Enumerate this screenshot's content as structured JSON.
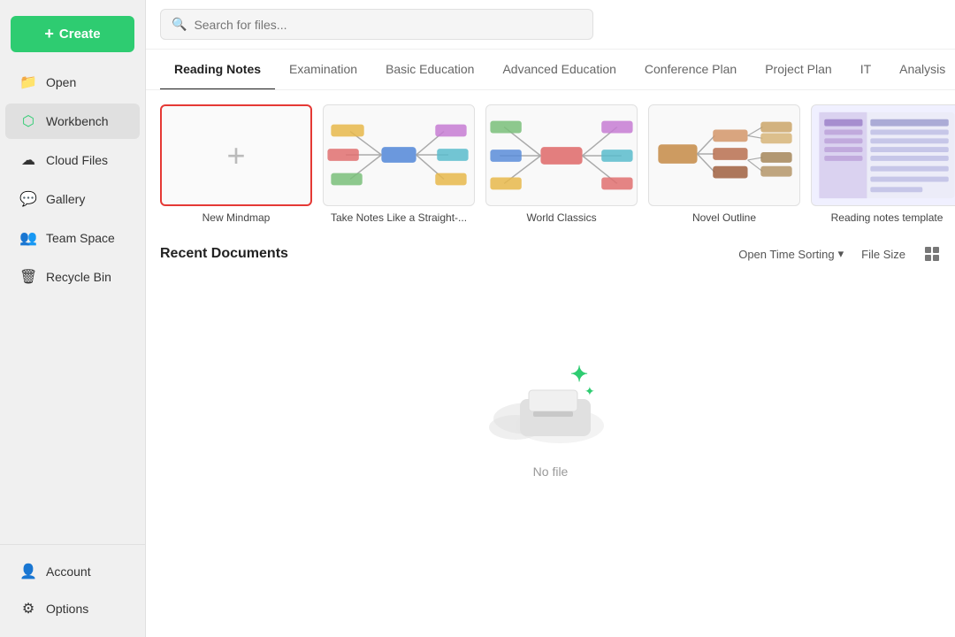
{
  "sidebar": {
    "create_label": "Create",
    "items": [
      {
        "id": "open",
        "label": "Open",
        "icon": "📁"
      },
      {
        "id": "workbench",
        "label": "Workbench",
        "icon": "🟢",
        "active": true
      },
      {
        "id": "cloud-files",
        "label": "Cloud Files",
        "icon": "☁️"
      },
      {
        "id": "gallery",
        "label": "Gallery",
        "icon": "💬"
      },
      {
        "id": "team-space",
        "label": "Team Space",
        "icon": "👥"
      },
      {
        "id": "recycle-bin",
        "label": "Recycle Bin",
        "icon": "🗑️"
      }
    ],
    "bottom_items": [
      {
        "id": "account",
        "label": "Account",
        "icon": "👤"
      },
      {
        "id": "options",
        "label": "Options",
        "icon": "⚙️"
      }
    ]
  },
  "topbar": {
    "search_placeholder": "Search for files..."
  },
  "tabs": [
    {
      "id": "reading-notes",
      "label": "Reading Notes",
      "active": true
    },
    {
      "id": "examination",
      "label": "Examination",
      "active": false
    },
    {
      "id": "basic-education",
      "label": "Basic Education",
      "active": false
    },
    {
      "id": "advanced-education",
      "label": "Advanced Education",
      "active": false
    },
    {
      "id": "conference-plan",
      "label": "Conference Plan",
      "active": false
    },
    {
      "id": "project-plan",
      "label": "Project Plan",
      "active": false
    },
    {
      "id": "it",
      "label": "IT",
      "active": false
    },
    {
      "id": "analysis",
      "label": "Analysis",
      "active": false
    }
  ],
  "templates": [
    {
      "id": "new-mindmap",
      "label": "New Mindmap",
      "type": "new"
    },
    {
      "id": "take-notes",
      "label": "Take Notes Like a Straight-...",
      "type": "mindmap1"
    },
    {
      "id": "world-classics",
      "label": "World Classics",
      "type": "mindmap2"
    },
    {
      "id": "novel-outline",
      "label": "Novel Outline",
      "type": "mindmap3"
    },
    {
      "id": "reading-notes-template",
      "label": "Reading notes template",
      "type": "table"
    }
  ],
  "recent_documents": {
    "title": "Recent Documents",
    "sort_label": "Open Time Sorting",
    "file_size_label": "File Size",
    "empty_label": "No file"
  }
}
